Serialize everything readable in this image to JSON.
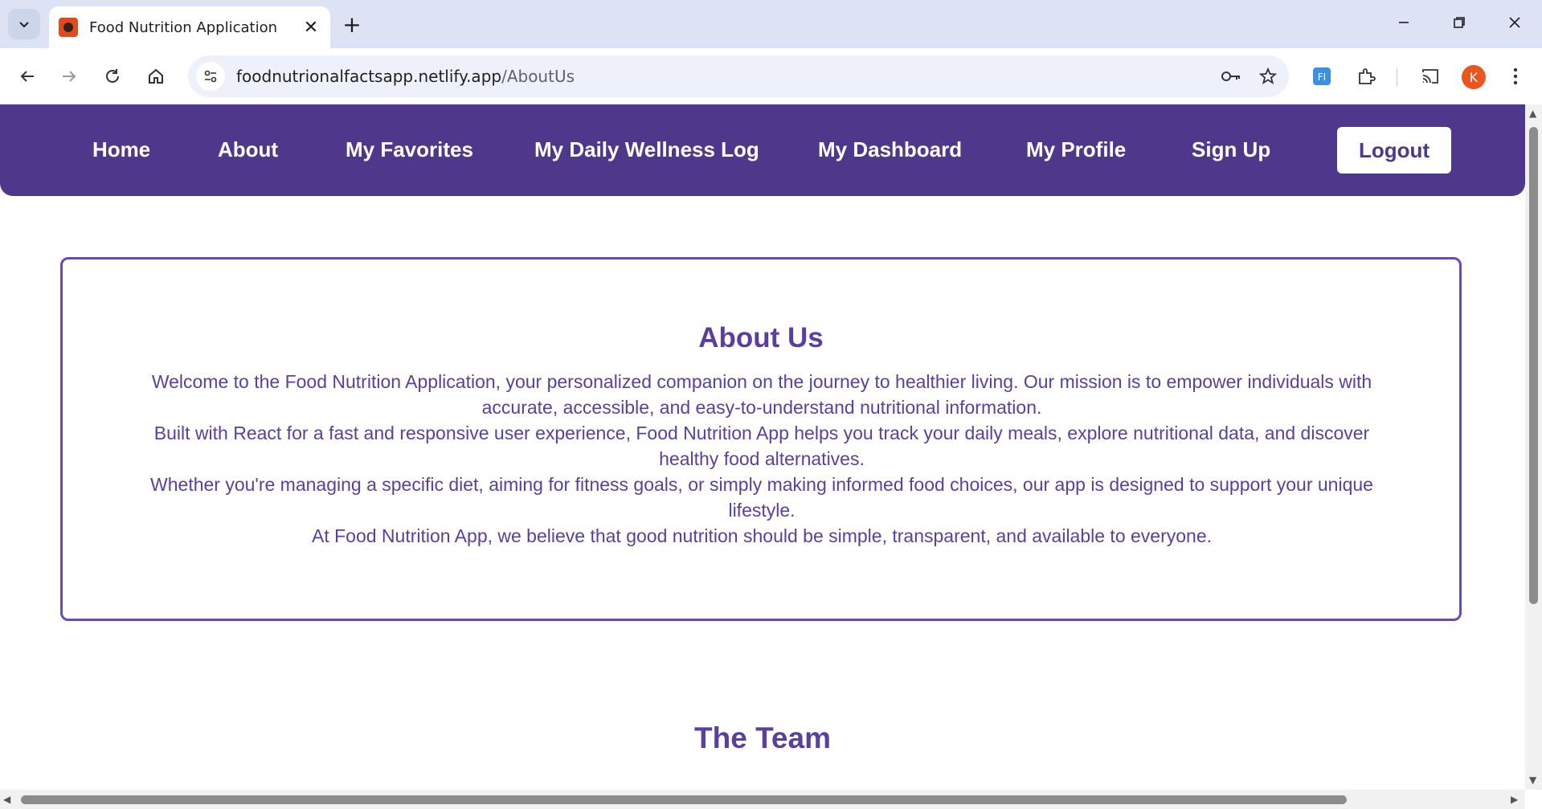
{
  "browser": {
    "tab_title": "Food Nutrition Application",
    "url_host": "foodnutrionalfactsapp.netlify.app",
    "url_path": "/AboutUs",
    "profile_initial": "K"
  },
  "nav": {
    "items": [
      "Home",
      "About",
      "My Favorites",
      "My Daily Wellness Log",
      "My Dashboard",
      "My Profile",
      "Sign Up"
    ],
    "logout_label": "Logout"
  },
  "about": {
    "title": "About Us",
    "paragraphs": [
      "Welcome to the Food Nutrition Application, your personalized companion on the journey to healthier living. Our mission is to empower individuals with accurate, accessible, and easy-to-understand nutritional information.",
      "Built with React for a fast and responsive user experience, Food Nutrition App helps you track your daily meals, explore nutritional data, and discover healthy food alternatives.",
      "Whether you're managing a specific diet, aiming for fitness goals, or simply making informed food choices, our app is designed to support your unique lifestyle.",
      "At Food Nutrition App, we believe that good nutrition should be simple, transparent, and available to everyone."
    ]
  },
  "team": {
    "title": "The Team"
  },
  "colors": {
    "brand": "#4f378b",
    "text": "#5b3f9e",
    "border": "#6a4bb5"
  }
}
